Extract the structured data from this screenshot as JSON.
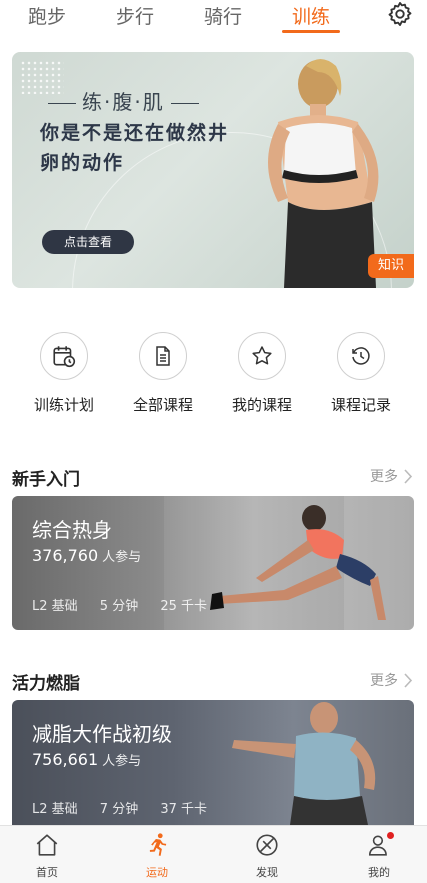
{
  "top_tabs": [
    "跑步",
    "步行",
    "骑行",
    "训练"
  ],
  "active_tab": "训练",
  "banner": {
    "kicker": "练·腹·肌",
    "title": "你是不是还在做然井卵的动作",
    "button": "点击查看",
    "badge": "知识"
  },
  "quick_actions": [
    {
      "label": "训练计划",
      "icon": "calendar-clock-icon"
    },
    {
      "label": "全部课程",
      "icon": "document-icon"
    },
    {
      "label": "我的课程",
      "icon": "star-icon"
    },
    {
      "label": "课程记录",
      "icon": "history-clock-icon"
    }
  ],
  "sections": [
    {
      "title": "新手入门",
      "more": "更多",
      "course": {
        "title": "综合热身",
        "count": "376,760",
        "count_unit": "人参与",
        "level": "L2 基础",
        "duration": "5 分钟",
        "calories": "25 千卡"
      }
    },
    {
      "title": "活力燃脂",
      "more": "更多",
      "course": {
        "title": "减脂大作战初级",
        "count": "756,661",
        "count_unit": "人参与",
        "level": "L2 基础",
        "duration": "7 分钟",
        "calories": "37 千卡"
      }
    }
  ],
  "bottom_nav": [
    {
      "label": "首页",
      "icon": "home-icon"
    },
    {
      "label": "运动",
      "icon": "running-icon"
    },
    {
      "label": "发现",
      "icon": "compass-icon"
    },
    {
      "label": "我的",
      "icon": "profile-icon"
    }
  ],
  "colors": {
    "accent": "#f26a1b",
    "badge_dot": "#e02020"
  }
}
